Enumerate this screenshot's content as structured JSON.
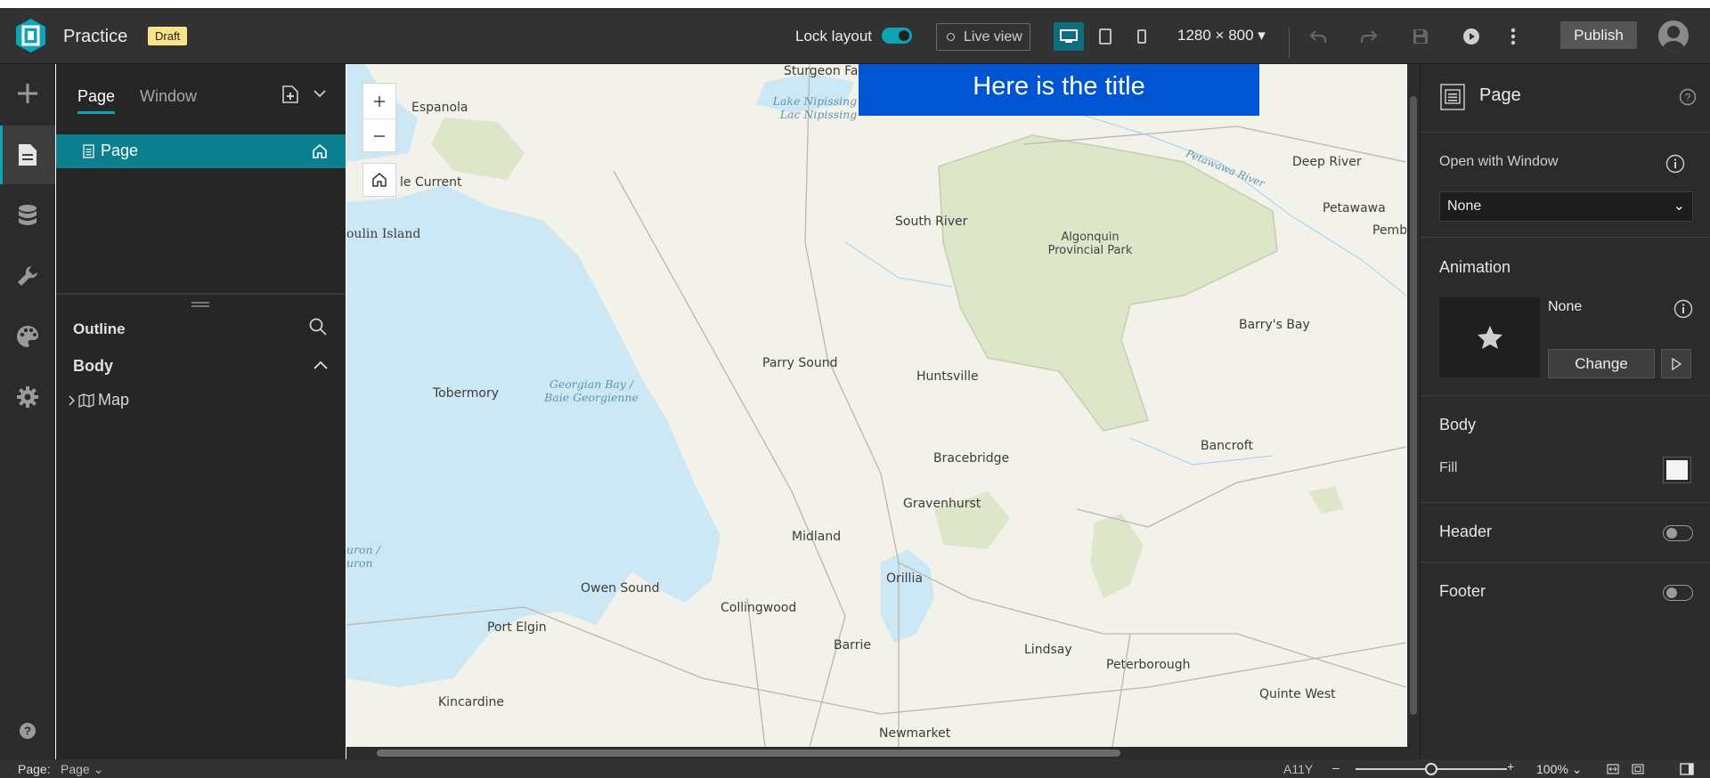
{
  "header": {
    "app_title": "Practice",
    "badge": "Draft",
    "lock_layout_label": "Lock layout",
    "lock_layout_on": true,
    "live_view_label": "Live view",
    "resolution": "1280 × 800",
    "publish_label": "Publish",
    "accent_color": "#0ca4b6"
  },
  "left_panel": {
    "tabs": [
      {
        "label": "Page",
        "active": true
      },
      {
        "label": "Window",
        "active": false
      }
    ],
    "pages": [
      {
        "label": "Page",
        "is_home": true
      }
    ],
    "outline": {
      "title": "Outline",
      "section": "Body",
      "items": [
        {
          "label": "Map",
          "icon": "map-icon"
        }
      ]
    }
  },
  "canvas": {
    "title_banner": "Here is the title",
    "banner_color": "#0056d2",
    "map_labels": [
      "Sturgeon Fa",
      "Lake Nipissing /",
      "Lac Nipissing",
      "Espanola",
      "le Current",
      "oulin Island",
      "South River",
      "Algonquin",
      "Provincial Park",
      "Deep River",
      "Petawawa",
      "Pembro",
      "Petawawa River",
      "Barry's Bay",
      "Parry Sound",
      "Huntsville",
      "Georgian Bay /",
      "Baie Georgienne",
      "Tobermory",
      "Bracebridge",
      "Bancroft",
      "Gravenhurst",
      "Midland",
      "uron /",
      "uron",
      "Orillia",
      "Owen Sound",
      "Collingwood",
      "Port Elgin",
      "Barrie",
      "Lindsay",
      "Peterborough",
      "Quinte West",
      "Kincardine",
      "Newmarket"
    ]
  },
  "right_panel": {
    "title": "Page",
    "open_with_window_label": "Open with Window",
    "open_with_window_value": "None",
    "animation_label": "Animation",
    "animation_value": "None",
    "change_label": "Change",
    "body_label": "Body",
    "fill_label": "Fill",
    "fill_color": "#f4f4f4",
    "header_label": "Header",
    "header_on": false,
    "footer_label": "Footer",
    "footer_on": false
  },
  "status_bar": {
    "page_label": "Page:",
    "page_value": "Page",
    "a11y_label": "A11Y",
    "zoom_value": "100%",
    "zoom_level": 0.5
  }
}
